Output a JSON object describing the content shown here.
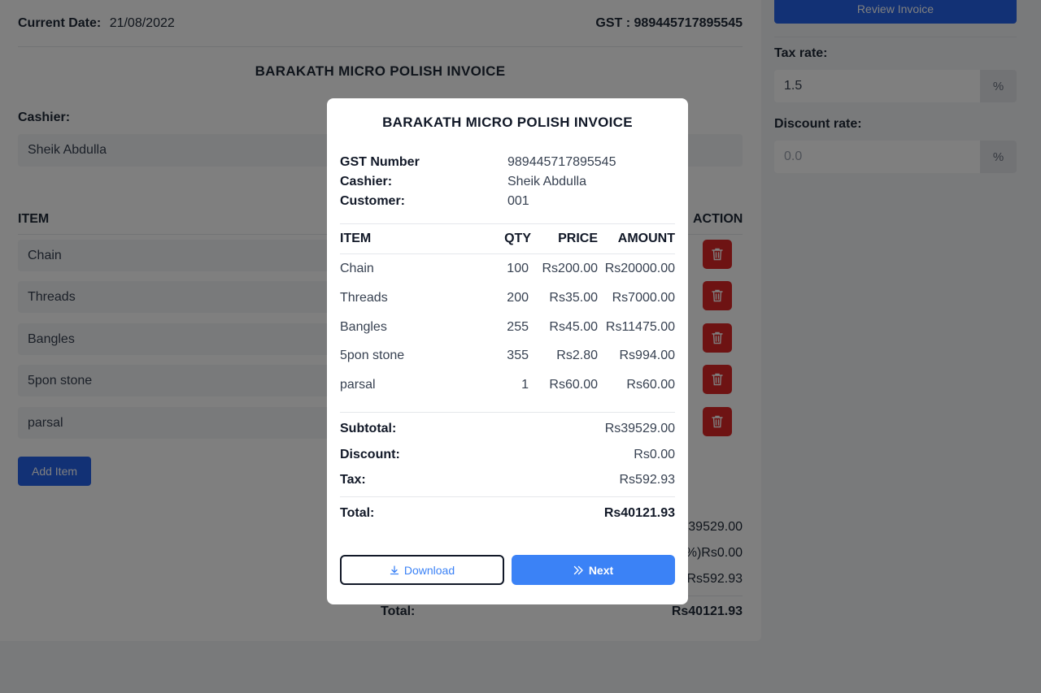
{
  "page": {
    "current_date_label": "Current Date:",
    "current_date": "21/08/2022",
    "gst_text": "GST : 989445717895545",
    "invoice_title": "BARAKATH MICRO POLISH INVOICE",
    "cashier_label": "Cashier:",
    "cashier_value": "Sheik Abdulla",
    "item_header": "ITEM",
    "action_header": "ACTION",
    "items": [
      {
        "name": "Chain"
      },
      {
        "name": "Threads"
      },
      {
        "name": "Bangles"
      },
      {
        "name": "5pon stone"
      },
      {
        "name": "parsal"
      }
    ],
    "add_item_label": "Add Item",
    "summary": {
      "subtotal_partial": "39529.00",
      "discount_partial": "%)Rs0.00",
      "tax_partial": "Rs592.93",
      "total_label": "Total:",
      "total_value": "Rs40121.93"
    }
  },
  "sidebar": {
    "review_button": "Review Invoice",
    "tax_label": "Tax rate:",
    "tax_value": "1.5",
    "discount_label": "Discount rate:",
    "discount_placeholder": "0.0",
    "percent_symbol": "%"
  },
  "modal": {
    "title": "BARAKATH MICRO POLISH INVOICE",
    "gst_label": "GST Number",
    "gst_value": "989445717895545",
    "cashier_label": "Cashier:",
    "cashier_value": "Sheik Abdulla",
    "customer_label": "Customer:",
    "customer_value": "001",
    "headers": {
      "item": "ITEM",
      "qty": "QTY",
      "price": "PRICE",
      "amount": "AMOUNT"
    },
    "rows": [
      {
        "item": "Chain",
        "qty": "100",
        "price": "Rs200.00",
        "amount": "Rs20000.00"
      },
      {
        "item": "Threads",
        "qty": "200",
        "price": "Rs35.00",
        "amount": "Rs7000.00"
      },
      {
        "item": "Bangles",
        "qty": "255",
        "price": "Rs45.00",
        "amount": "Rs11475.00"
      },
      {
        "item": "5pon stone",
        "qty": "355",
        "price": "Rs2.80",
        "amount": "Rs994.00"
      },
      {
        "item": "parsal",
        "qty": "1",
        "price": "Rs60.00",
        "amount": "Rs60.00"
      }
    ],
    "subtotal_label": "Subtotal:",
    "subtotal_value": "Rs39529.00",
    "discount_label": "Discount:",
    "discount_value": "Rs0.00",
    "tax_label": "Tax:",
    "tax_value": "Rs592.93",
    "total_label": "Total:",
    "total_value": "Rs40121.93",
    "download_label": "Download",
    "next_label": "Next"
  },
  "colors": {
    "primary": "#2563eb",
    "next_button": "#3b82f6",
    "danger": "#dc2626"
  }
}
